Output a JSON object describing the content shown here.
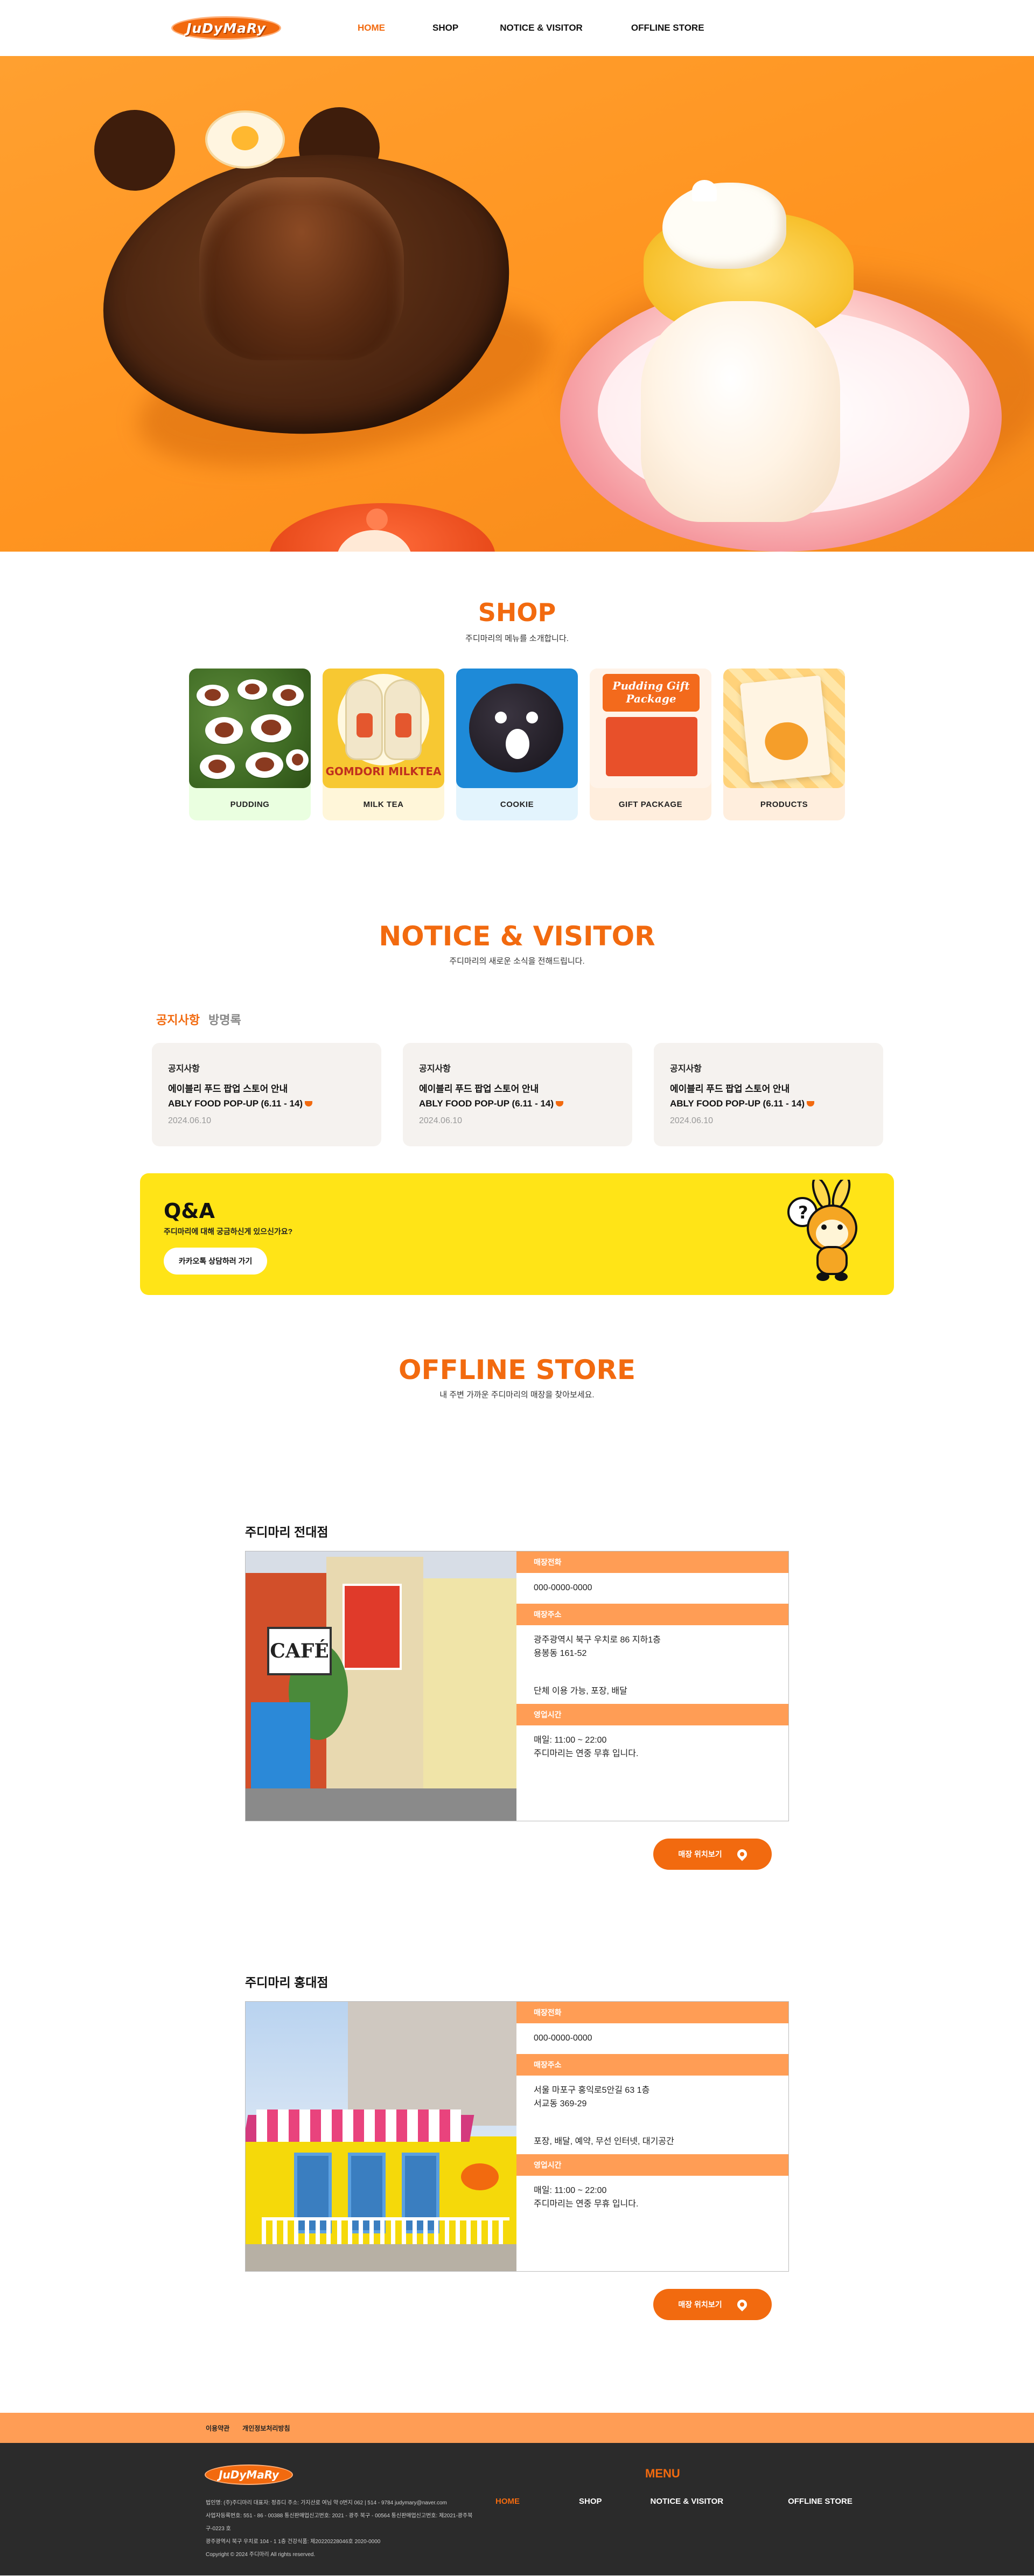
{
  "header": {
    "logo_text": "JuDyMaRy",
    "nav": [
      "HOME",
      "SHOP",
      "NOTICE & VISITOR",
      "OFFLINE STORE"
    ],
    "active": "HOME"
  },
  "shop": {
    "title": "SHOP",
    "subtitle": "주디마리의 메뉴를 소개합니다.",
    "items": [
      "PUDDING",
      "MILK TEA",
      "COOKIE",
      "GIFT PACKAGE",
      "PRODUCTS"
    ],
    "milk_tea_art_text": "GOMDORI MILKTEA",
    "gift_art_text": "Pudding Gift Package"
  },
  "notice": {
    "title": "NOTICE & VISITOR",
    "subtitle": "주디마리의 새로운 소식을 전해드립니다.",
    "tabs": [
      "공지사항",
      "방명록"
    ],
    "cards": [
      {
        "category": "공지사항",
        "line1": "에이블리 푸드 팝업 스토어 안내",
        "line2": "ABLY FOOD POP-UP (6.11 - 14)",
        "date": "2024.06.10"
      },
      {
        "category": "공지사항",
        "line1": "에이블리 푸드 팝업 스토어 안내",
        "line2": "ABLY FOOD POP-UP (6.11 - 14)",
        "date": "2024.06.10"
      },
      {
        "category": "공지사항",
        "line1": "에이블리 푸드 팝업 스토어 안내",
        "line2": "ABLY FOOD POP-UP (6.11 - 14)",
        "date": "2024.06.10"
      }
    ]
  },
  "qa": {
    "title": "Q&A",
    "subtitle": "주디마리에 대해 궁금하신게 있으신가요?",
    "button": "카카오톡 상담하러 가기"
  },
  "offline": {
    "title": "OFFLINE STORE",
    "subtitle": "내 주변 가까운 주디마리의 매장을 찾아보세요.",
    "button": "매장 위치보기",
    "stores": [
      {
        "name": "주디마리 전대점",
        "phone_label": "매장전화",
        "phone": "000-0000-0000",
        "address_label": "매장주소",
        "address1": "광주광역시 북구 우치로 86 지하1층",
        "address2": "용봉동 161-52",
        "services": "단체 이용 가능, 포장, 배달",
        "hours_label": "영업시간",
        "hours": "매일: 11:00 ~ 22:00",
        "holiday": "주디마리는 연중 무휴 입니다.",
        "photo_sign_text": "CAFÉ"
      },
      {
        "name": "주디마리 홍대점",
        "phone_label": "매장전화",
        "phone": "000-0000-0000",
        "address_label": "매장주소",
        "address1": "서울 마포구 홍익로5안길 63 1층",
        "address2": "서교동 369-29",
        "services": "포장, 배달, 예약, 무선 인터넷, 대기공간",
        "hours_label": "영업시간",
        "hours": "매일: 11:00 ~ 22:00",
        "holiday": "주디마리는 연중 무휴 입니다."
      }
    ]
  },
  "footer": {
    "links": [
      "이용약관",
      "개인정보처리방침"
    ],
    "logo_text": "JuDyMaRy",
    "info": [
      "법인명: (주)주디마리    대표자: 정쥬디    주소: 가지산로 여님 약 0번지    062 | 514 - 9784    judymary@naver.com",
      "사업자등록번호: 551 - 86 - 00388    통신판매업신고번호: 2021 - 광주 북구 - 00564    통신판매업신고번호: 제2021-광주북구-0223 호",
      "광주광역시 북구 우치로 104 - 1 1층    건강식품: 제20220228046호 2020-0000",
      "Copyright © 2024 주디마리 All rights reserved."
    ],
    "menu_title": "MENU",
    "nav": [
      "HOME",
      "SHOP",
      "NOTICE & VISITOR",
      "OFFLINE STORE"
    ]
  },
  "colors": {
    "accent": "#f26a0f",
    "accent_light": "#ff9d55",
    "qa_yellow": "#ffe417",
    "footer_dark": "#2b2b2b"
  }
}
